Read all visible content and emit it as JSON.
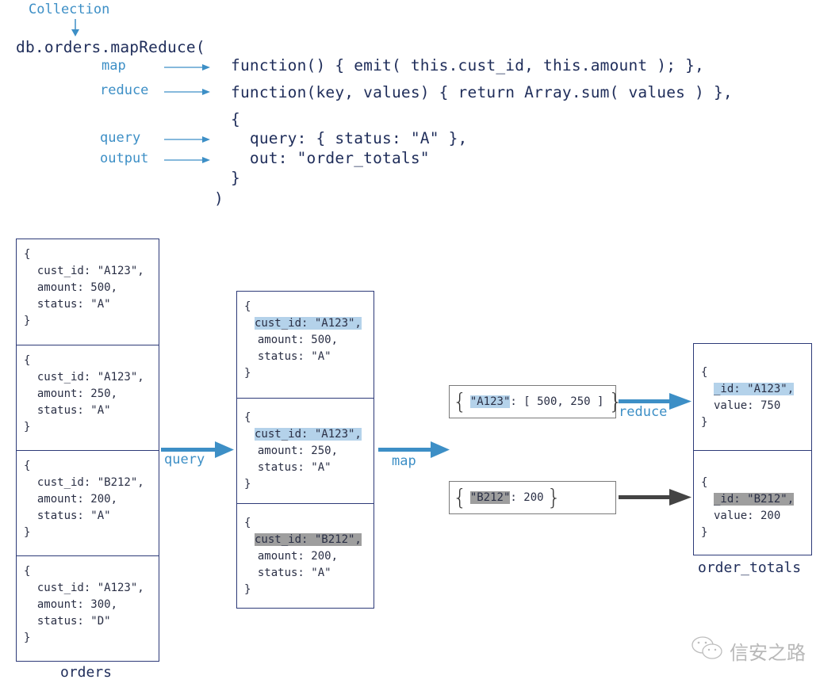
{
  "header": {
    "collection_label": "Collection",
    "call_line": "db.orders.mapReduce(",
    "closing_paren": ")",
    "params": [
      {
        "label": "map",
        "code": "function() { emit( this.cust_id, this.amount ); },"
      },
      {
        "label": "reduce",
        "code": "function(key, values) { return Array.sum( values ) },"
      },
      {
        "label": "query",
        "code": "  query: { status: \"A\" },"
      },
      {
        "label": "output",
        "code": "  out: \"order_totals\""
      }
    ],
    "open_brace": "{",
    "close_brace": "}"
  },
  "orders": {
    "caption": "orders",
    "docs": [
      {
        "open": "{",
        "cust_id": "  cust_id: \"A123\",",
        "amount": "  amount: 500,",
        "status": "  status: \"A\"",
        "close": "}"
      },
      {
        "open": "{",
        "cust_id": "  cust_id: \"A123\",",
        "amount": "  amount: 250,",
        "status": "  status: \"A\"",
        "close": "}"
      },
      {
        "open": "{",
        "cust_id": "  cust_id: \"B212\",",
        "amount": "  amount: 200,",
        "status": "  status: \"A\"",
        "close": "}"
      },
      {
        "open": "{",
        "cust_id": "  cust_id: \"A123\",",
        "amount": "  amount: 300,",
        "status": "  status: \"D\"",
        "close": "}"
      }
    ]
  },
  "query_stage": {
    "arrow_label": "query",
    "docs": [
      {
        "open": "{",
        "cust_id": "cust_id: \"A123\",",
        "amount": "  amount: 500,",
        "status": "  status: \"A\"",
        "close": "}",
        "highlight": "blue"
      },
      {
        "open": "{",
        "cust_id": "cust_id: \"A123\",",
        "amount": "  amount: 250,",
        "status": "  status: \"A\"",
        "close": "}",
        "highlight": "blue"
      },
      {
        "open": "{",
        "cust_id": "cust_id: \"B212\",",
        "amount": "  amount: 200,",
        "status": "  status: \"A\"",
        "close": "}",
        "highlight": "gray"
      }
    ]
  },
  "map_stage": {
    "arrow_label": "map",
    "pairs": [
      {
        "open": "{",
        "key": "\"A123\"",
        "value": ": [ 500, 250 ]",
        "close": "}",
        "highlight": "blue"
      },
      {
        "open": "{",
        "key": "\"B212\"",
        "value": ": 200",
        "close": "}",
        "highlight": "gray"
      }
    ]
  },
  "reduce_stage": {
    "arrow_label": "reduce"
  },
  "order_totals": {
    "caption": "order_totals",
    "docs": [
      {
        "open": "{",
        "id": "_id: \"A123\",",
        "value": "value: 750",
        "close": "}",
        "highlight": "blue"
      },
      {
        "open": "{",
        "id": "_id: \"B212\",",
        "value": "value: 200",
        "close": "}",
        "highlight": "gray"
      }
    ]
  },
  "watermark": {
    "text": "信安之路",
    "icon": "wechat-icon"
  },
  "colors": {
    "accent_blue": "#3d8fc6",
    "navy": "#1f2d5a",
    "highlight_blue": "#b4d2ea",
    "highlight_gray": "#9e9e9e",
    "dark_arrow": "#444444"
  }
}
